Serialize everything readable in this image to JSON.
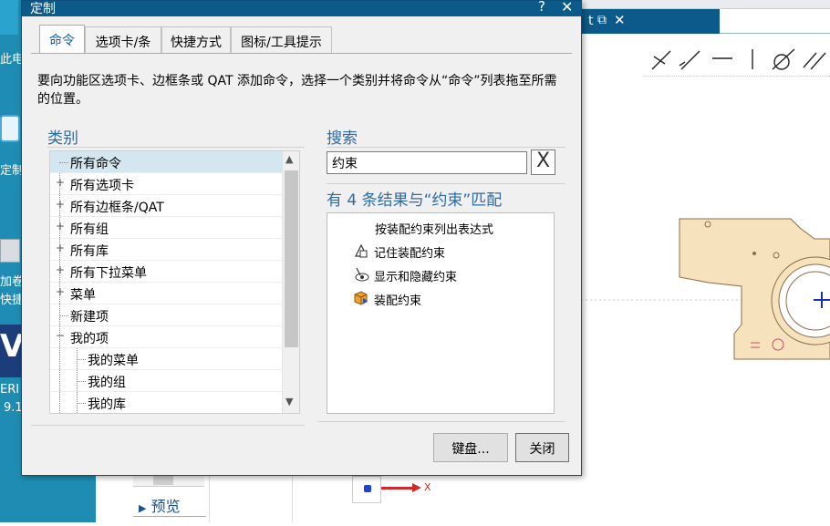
{
  "desktop": {
    "icons": [
      {
        "label": "此电"
      },
      {
        "label": "定制["
      },
      {
        "label": "加卷"
      },
      {
        "label": "快捷"
      },
      {
        "label": "ERI"
      },
      {
        "label": "9.1"
      }
    ]
  },
  "app": {
    "tab_label": "t",
    "preview_label": "预览",
    "axis_label": "X"
  },
  "dialog": {
    "title": "定制",
    "help_icon": "?",
    "close_icon": "✕",
    "tabs": [
      {
        "label": "命令",
        "active": true
      },
      {
        "label": "选项卡/条",
        "active": false
      },
      {
        "label": "快捷方式",
        "active": false
      },
      {
        "label": "图标/工具提示",
        "active": false
      }
    ],
    "description": "要向功能区选项卡、边框条或 QAT 添加命令，选择一个类别并将命令从“命令”列表拖至所需的位置。",
    "category": {
      "heading": "类别",
      "items": [
        {
          "label": "所有命令",
          "expander": "",
          "selected": true,
          "level": 0
        },
        {
          "label": "所有选项卡",
          "expander": "+",
          "selected": false,
          "level": 0
        },
        {
          "label": "所有边框条/QAT",
          "expander": "+",
          "selected": false,
          "level": 0
        },
        {
          "label": "所有组",
          "expander": "+",
          "selected": false,
          "level": 0
        },
        {
          "label": "所有库",
          "expander": "+",
          "selected": false,
          "level": 0
        },
        {
          "label": "所有下拉菜单",
          "expander": "+",
          "selected": false,
          "level": 0
        },
        {
          "label": "菜单",
          "expander": "+",
          "selected": false,
          "level": 0
        },
        {
          "label": "新建项",
          "expander": "",
          "selected": false,
          "level": 0
        },
        {
          "label": "我的项",
          "expander": "−",
          "selected": false,
          "level": 0
        },
        {
          "label": "我的菜单",
          "expander": "",
          "selected": false,
          "level": 1
        },
        {
          "label": "我的组",
          "expander": "",
          "selected": false,
          "level": 1
        },
        {
          "label": "我的库",
          "expander": "",
          "selected": false,
          "level": 1
        }
      ]
    },
    "search": {
      "heading": "搜索",
      "value": "约束",
      "clear_icon": "X",
      "result_count": "有 4 条结果与“约束”匹配",
      "group_label": "按装配约束列出表达式",
      "results": [
        {
          "label": "记住装配约束",
          "icon": "remember-constraint-icon"
        },
        {
          "label": "显示和隐藏约束",
          "icon": "show-hide-constraint-icon"
        },
        {
          "label": "装配约束",
          "icon": "assembly-constraint-icon"
        }
      ]
    },
    "buttons": {
      "keyboard": "键盘...",
      "close": "关闭"
    }
  }
}
